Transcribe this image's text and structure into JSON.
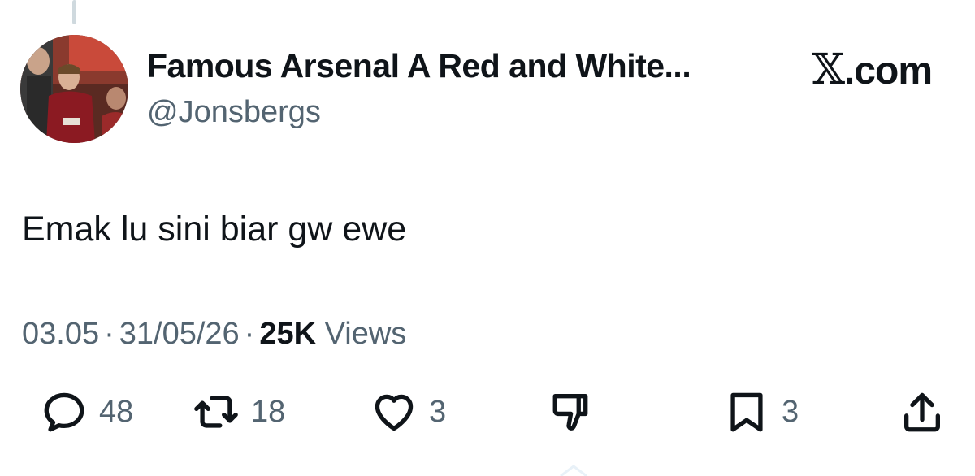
{
  "author": {
    "display_name": "Famous Arsenal A Red and White...",
    "handle": "@Jonsbergs",
    "avatar_icon": "profile-photo"
  },
  "brand": {
    "glyph": "𝕏",
    "suffix": ".com"
  },
  "tweet": {
    "text": "Emak lu sini biar gw ewe",
    "time": "03.05",
    "date": "31/05/26",
    "separator": "·",
    "views_count": "25K",
    "views_label": "Views"
  },
  "actions": {
    "reply": {
      "icon": "reply-icon",
      "count": "48"
    },
    "retweet": {
      "icon": "retweet-icon",
      "count": "18"
    },
    "like": {
      "icon": "heart-icon",
      "count": "3"
    },
    "downvote": {
      "icon": "thumbs-down-icon"
    },
    "bookmark": {
      "icon": "bookmark-icon",
      "count": "3"
    },
    "share": {
      "icon": "share-icon"
    }
  },
  "colors": {
    "primary_text": "#0f1419",
    "secondary_text": "#536471",
    "thread_line": "#cfd9de"
  }
}
